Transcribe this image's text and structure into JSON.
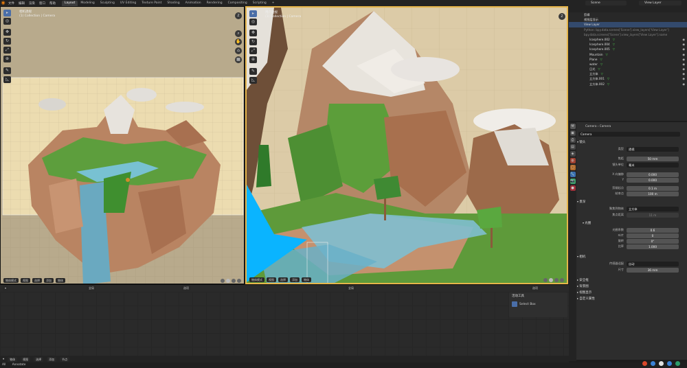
{
  "topbar": {
    "menus": [
      "文件",
      "编辑",
      "渲染",
      "窗口",
      "帮助"
    ],
    "workspaces": [
      "Layout",
      "Modeling",
      "Sculpting",
      "UV Editing",
      "Texture Paint",
      "Shading",
      "Animation",
      "Rendering",
      "Compositing",
      "Scripting"
    ],
    "active_workspace": "Layout",
    "add_tab": "+",
    "scene_name": "Scene",
    "view_layer": "View Layer"
  },
  "viewport_left": {
    "title": "相机透视",
    "subtitle": "(1) Collection | Camera",
    "mode": "物体模式",
    "menus": [
      "视图",
      "选择",
      "添加",
      "物体"
    ],
    "global": "全局"
  },
  "viewport_right": {
    "title": "用户透视",
    "subtitle": "(1) Collection | Camera",
    "mode": "物体模式",
    "menus": [
      "视图",
      "选择",
      "添加",
      "物体"
    ],
    "global": "全局",
    "select_label": "选项"
  },
  "outliner": {
    "rows": [
      {
        "label": "剪辑",
        "kind": "plain"
      },
      {
        "label": "视图层显示",
        "kind": "plain"
      },
      {
        "label": "View Layer",
        "kind": "selected"
      },
      {
        "label": "Python: bpy.data.scenes['Scene'].view_layers['View Layer']",
        "kind": "code"
      },
      {
        "label": "bpy.data.screens['Scene'].view_layers['View Layer'].name",
        "kind": "code"
      },
      {
        "label": "Icosphere.002",
        "kind": "obj"
      },
      {
        "label": "Icosphere.004",
        "kind": "obj"
      },
      {
        "label": "Icosphere.005",
        "kind": "obj"
      },
      {
        "label": "Mountain",
        "kind": "obj"
      },
      {
        "label": "Plane",
        "kind": "obj"
      },
      {
        "label": "water",
        "kind": "obj"
      },
      {
        "label": "日光",
        "kind": "obj"
      },
      {
        "label": "立方体",
        "kind": "obj"
      },
      {
        "label": "立方体.001",
        "kind": "obj"
      },
      {
        "label": "立方体.002",
        "kind": "obj"
      }
    ]
  },
  "properties": {
    "breadcrumb": [
      "Camera",
      "Camera"
    ],
    "datablock": "Camera",
    "lens_section": "镜头",
    "fields": [
      {
        "label": "类型",
        "value": "透视",
        "style": "dark"
      },
      {
        "label": "焦距",
        "value": "50 mm",
        "style": "normal"
      },
      {
        "label": "镜头单位",
        "value": "毫米",
        "style": "dark"
      },
      {
        "label": "X 向偏移",
        "value": "0.000",
        "style": "normal"
      },
      {
        "label": "Y",
        "value": "0.000",
        "style": "normal"
      },
      {
        "label": "剪裁起点",
        "value": "0.1 m",
        "style": "normal"
      },
      {
        "label": "结束点",
        "value": "100 m",
        "style": "normal"
      }
    ],
    "dof_section": "景深",
    "focus_label": "聚焦到物体",
    "focus_value": "立方体",
    "focus_dist_label": "焦点距离",
    "focus_dist_value": "11 m",
    "aperture_section": "光圈",
    "aperture_fields": [
      {
        "label": "光圈系数",
        "value": "0.6"
      },
      {
        "label": "叶片",
        "value": "0"
      },
      {
        "label": "旋转",
        "value": "0°"
      },
      {
        "label": "比率",
        "value": "1.000"
      }
    ],
    "sensor_section": "相机",
    "sensor_fit_label": "传感器适配",
    "sensor_fit_value": "自动",
    "size_label": "尺寸",
    "size_value": "36 mm",
    "collapsed_sections": [
      "安全框",
      "背景图",
      "视图显示",
      "自定义属性"
    ]
  },
  "timeline": {
    "mode": "物体",
    "menus": [
      "视图",
      "选择",
      "添加",
      "节点"
    ],
    "frame_label": "全局",
    "select_label": "选项"
  },
  "tool_panel": {
    "title": "活动工具",
    "tool": "Select Box"
  },
  "status": {
    "left": "All",
    "mode_text": "Annotate"
  },
  "colors": {
    "accent": "#e6b54a",
    "selection": "#334a6d",
    "object_triangle": "#4ec94e",
    "camera_blue": "#0ab4ff"
  }
}
